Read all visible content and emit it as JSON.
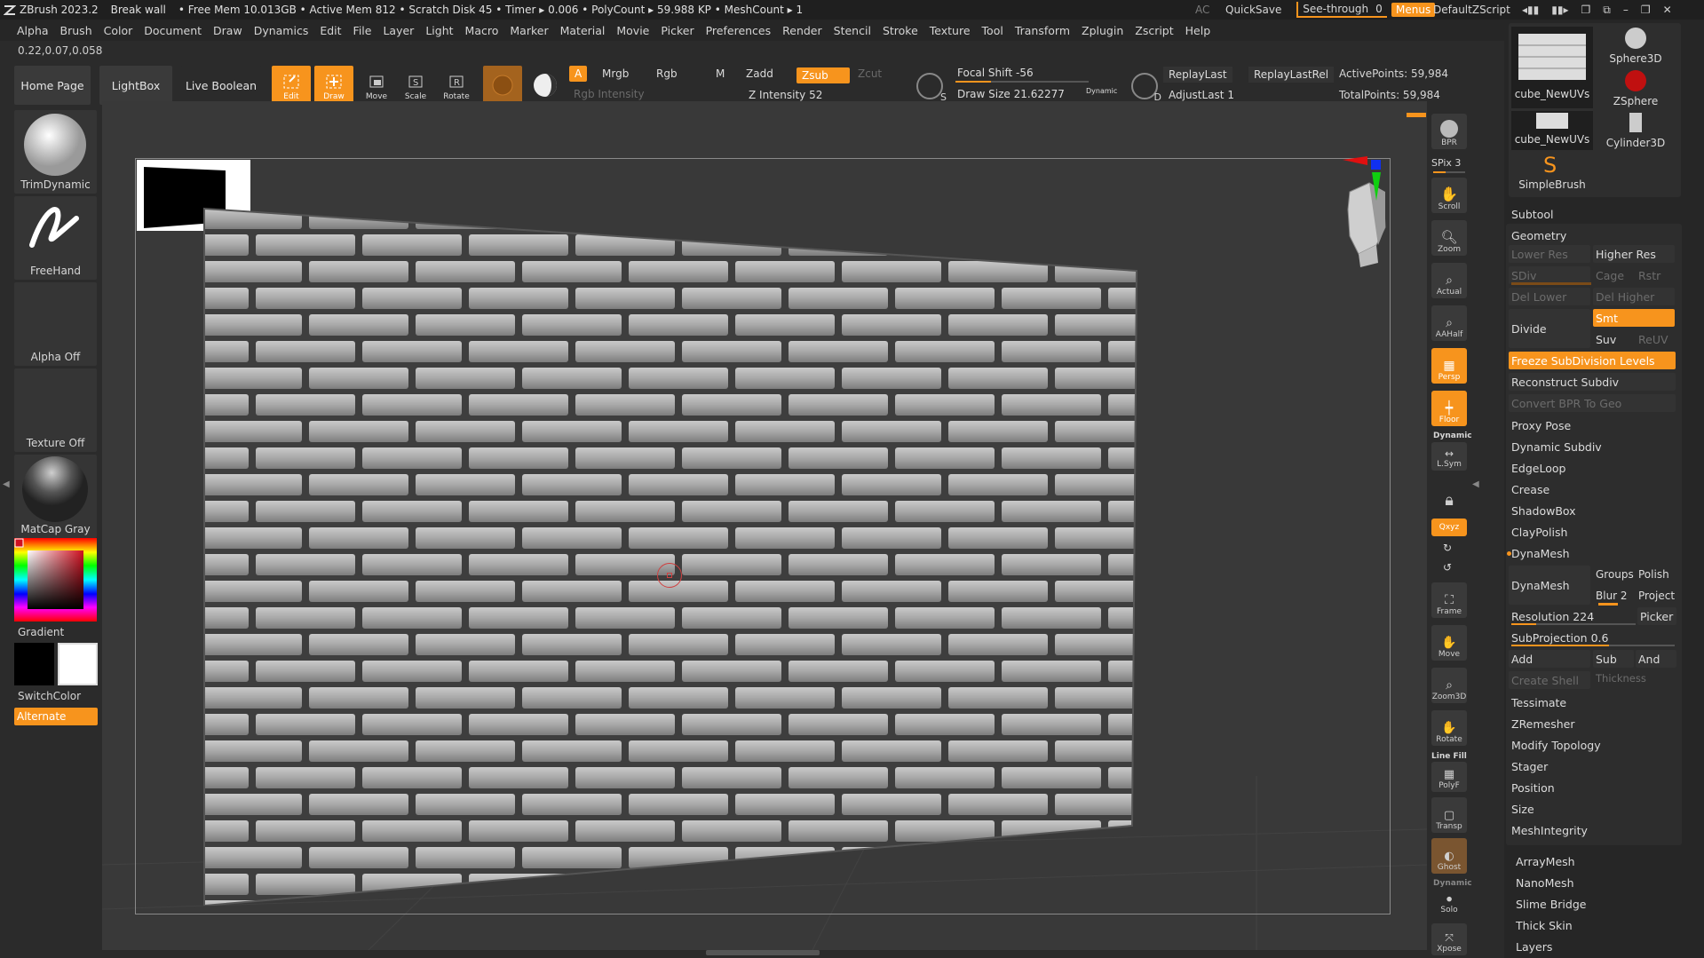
{
  "titlebar": {
    "app": "ZBrush 2023.2",
    "project": "Break wall",
    "stats": "• Free Mem 10.013GB • Active Mem 812 • Scratch Disk 45 • Timer ▸ 0.006 • PolyCount ▸ 59.988 KP • MeshCount ▸ 1",
    "ac": "AC",
    "quicksave": "QuickSave",
    "see_through": "See-through",
    "see_through_value": "0",
    "menus": "Menus",
    "script": "DefaultZScript"
  },
  "menubar": [
    "Alpha",
    "Brush",
    "Color",
    "Document",
    "Draw",
    "Dynamics",
    "Edit",
    "File",
    "Layer",
    "Light",
    "Macro",
    "Marker",
    "Material",
    "Movie",
    "Picker",
    "Preferences",
    "Render",
    "Stencil",
    "Stroke",
    "Texture",
    "Tool",
    "Transform",
    "Zplugin",
    "Zscript",
    "Help"
  ],
  "coords": "0.22,0.07,0.058",
  "shelf": {
    "home": "Home Page",
    "lightbox": "LightBox",
    "live_boolean": "Live Boolean",
    "tools": [
      "Edit",
      "Draw",
      "Move",
      "Scale",
      "Rotate"
    ],
    "a": "A",
    "mrgb": "Mrgb",
    "rgb": "Rgb",
    "m": "M",
    "rgb_intensity": "Rgb Intensity",
    "zadd": "Zadd",
    "zsub": "Zsub",
    "zcut": "Zcut",
    "z_intensity": "Z Intensity 52",
    "focal_shift": "Focal Shift -56",
    "draw_size": "Draw Size 21.62277",
    "dynamic": "Dynamic",
    "replay_last": "ReplayLast",
    "replay_last_rel": "ReplayLastRel",
    "adjust_last": "AdjustLast 1",
    "active_points": "ActivePoints: 59,984",
    "total_points": "TotalPoints: 59,984",
    "s": "S",
    "d": "D"
  },
  "left_panel": {
    "brush": "TrimDynamic",
    "stroke": "FreeHand",
    "alpha": "Alpha Off",
    "texture": "Texture Off",
    "material": "MatCap Gray",
    "gradient": "Gradient",
    "switchcolor": "SwitchColor",
    "alternate": "Alternate"
  },
  "right_toolbar": {
    "bpr": "BPR",
    "spix": "SPix 3",
    "scroll": "Scroll",
    "zoom": "Zoom",
    "actual": "Actual",
    "aahalf": "AAHalf",
    "persp": "Persp",
    "floor": "Floor",
    "dynamic": "Dynamic",
    "lsym": "L.Sym",
    "xyz": "Qxyz",
    "frame": "Frame",
    "move": "Move",
    "zoom3d": "Zoom3D",
    "rotate": "Rotate",
    "linefill": "Line Fill",
    "polyf": "PolyF",
    "transp": "Transp",
    "ghost": "Ghost",
    "dynamic2": "Dynamic",
    "solo": "Solo",
    "xpose": "Xpose"
  },
  "tool_thumbs": [
    "cube_NewUVs",
    "Sphere3D",
    "ZSphere",
    "cube_NewUVs",
    "Cylinder3D",
    "SimpleBrush"
  ],
  "right_panel": {
    "subtool": "Subtool",
    "geometry": "Geometry",
    "lower_res": "Lower Res",
    "higher_res": "Higher Res",
    "sdiv": "SDiv",
    "cage": "Cage",
    "rstr": "Rstr",
    "del_lower": "Del Lower",
    "del_higher": "Del Higher",
    "divide": "Divide",
    "smt": "Smt",
    "suv": "Suv",
    "reuv": "ReUV",
    "freeze": "Freeze SubDivision Levels",
    "reconstruct": "Reconstruct Subdiv",
    "convert_bpr": "Convert BPR To Geo",
    "proxy_pose": "Proxy Pose",
    "dynamic_subdiv": "Dynamic Subdiv",
    "edgeloop": "EdgeLoop",
    "crease": "Crease",
    "shadowbox": "ShadowBox",
    "claypolish": "ClayPolish",
    "dynamesh_header": "DynaMesh",
    "dynamesh_btn": "DynaMesh",
    "groups": "Groups",
    "polish": "Polish",
    "blur": "Blur 2",
    "project": "Project",
    "resolution": "Resolution 224",
    "picker": "Picker",
    "subprojection": "SubProjection 0.6",
    "add": "Add",
    "sub": "Sub",
    "and": "And",
    "create_shell": "Create Shell",
    "thickness": "Thickness",
    "tessimate": "Tessimate",
    "zremesher": "ZRemesher",
    "modify_topology": "Modify Topology",
    "stager": "Stager",
    "position": "Position",
    "size": "Size",
    "meshintegrity": "MeshIntegrity",
    "arraymesh": "ArrayMesh",
    "nanomesh": "NanoMesh",
    "slime_bridge": "Slime Bridge",
    "thick_skin": "Thick Skin",
    "layers": "Layers"
  },
  "colors": {
    "accent": "#f7941d",
    "panel": "#262626",
    "viewport": "#393939"
  }
}
